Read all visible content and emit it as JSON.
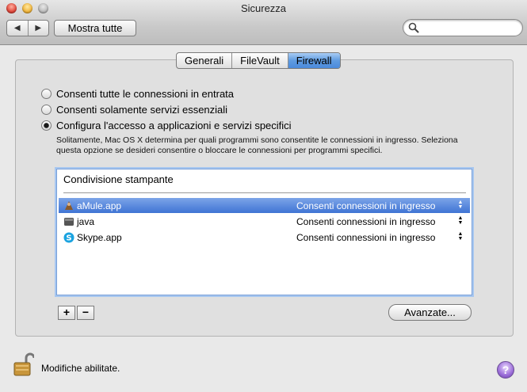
{
  "window": {
    "title": "Sicurezza"
  },
  "toolbar": {
    "back_glyph": "◀",
    "forward_glyph": "▶",
    "show_all_label": "Mostra tutte",
    "search": {
      "value": "",
      "placeholder": ""
    }
  },
  "tabs": [
    {
      "label": "Generali",
      "active": false
    },
    {
      "label": "FileVault",
      "active": false
    },
    {
      "label": "Firewall",
      "active": true
    }
  ],
  "options": [
    {
      "label": "Consenti tutte le connessioni in entrata",
      "checked": false
    },
    {
      "label": "Consenti solamente servizi essenziali",
      "checked": false
    },
    {
      "label": "Configura l'accesso a applicazioni e servizi specifici",
      "checked": true
    }
  ],
  "description": "Solitamente, Mac OS X determina per quali programmi sono consentite le connessioni in ingresso. Seleziona questa opzione se desideri consentire o bloccare le connessioni per programmi specifici.",
  "list": {
    "header": "Condivisione stampante",
    "rows": [
      {
        "name": "aMule.app",
        "status": "Consenti connessioni in ingresso",
        "selected": true,
        "icon": "amule-icon"
      },
      {
        "name": "java",
        "status": "Consenti connessioni in ingresso",
        "selected": false,
        "icon": "java-icon"
      },
      {
        "name": "Skype.app",
        "status": "Consenti connessioni in ingresso",
        "selected": false,
        "icon": "skype-icon"
      }
    ]
  },
  "controls": {
    "add_label": "+",
    "remove_label": "−",
    "advanced_label": "Avanzate..."
  },
  "footer": {
    "lock_label": "Modifiche abilitate.",
    "help_label": "?"
  }
}
